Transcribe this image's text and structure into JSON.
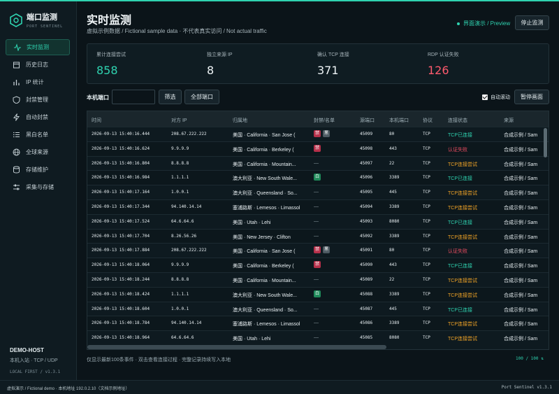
{
  "app": {
    "logo_title": "端口监测",
    "logo_subtitle": "PORT SENTINEL"
  },
  "sidebar": {
    "items": [
      {
        "label": "实时监测",
        "icon": "activity-icon",
        "active": true
      },
      {
        "label": "历史日志",
        "icon": "calendar-icon",
        "active": false
      },
      {
        "label": "IP 统计",
        "icon": "bar-chart-icon",
        "active": false
      },
      {
        "label": "封禁管理",
        "icon": "shield-icon",
        "active": false
      },
      {
        "label": "自动封禁",
        "icon": "bolt-icon",
        "active": false
      },
      {
        "label": "黑白名单",
        "icon": "list-icon",
        "active": false
      },
      {
        "label": "全球来源",
        "icon": "globe-icon",
        "active": false
      },
      {
        "label": "存储维护",
        "icon": "database-icon",
        "active": false
      },
      {
        "label": "采集与存储",
        "icon": "sliders-icon",
        "active": false
      }
    ],
    "host_name": "DEMO-HOST",
    "host_mode": "本机入站 · TCP / UDP",
    "version_line": "LOCAL FIRST  /  v1.3.1"
  },
  "header": {
    "title": "实时监测",
    "subtitle": "虚拟示例数据 / Fictional sample data · 不代表真实访问 / Not actual traffic",
    "preview_label": "界面演示 / Preview",
    "stop_button": "停止监测"
  },
  "stats": [
    {
      "label": "累计连接尝试",
      "value": "858",
      "color": "#2fd3b0"
    },
    {
      "label": "独立来源 IP",
      "value": "8",
      "color": "#eef4f6"
    },
    {
      "label": "确认 TCP 连接",
      "value": "371",
      "color": "#eef4f6"
    },
    {
      "label": "RDP 认证失败",
      "value": "126",
      "color": "#ff5a6e"
    }
  ],
  "filter": {
    "label": "本机端口",
    "input_value": "",
    "filter_button": "筛选",
    "all_ports_button": "全部端口",
    "auto_scroll_label": "自动滚动",
    "auto_scroll_checked": true,
    "pause_button": "暂停画面"
  },
  "table": {
    "columns": [
      "时间",
      "对方 IP",
      "归属地",
      "封禁/名单",
      "源端口",
      "本机端口",
      "协议",
      "连接状态",
      "来源"
    ],
    "rows": [
      {
        "time": "2026-09-13 15:40:16.444",
        "ip": "208.67.222.222",
        "location": "美国 · California · San Jose (",
        "badges": [
          "禁",
          "黑"
        ],
        "src_port": "45099",
        "local_port": "80",
        "proto": "TCP",
        "status": "TCP已连接",
        "status_type": "ok",
        "source": "合成示例 / Sam"
      },
      {
        "time": "2026-09-13 15:40:16.624",
        "ip": "9.9.9.9",
        "location": "美国 · California · Berkeley (",
        "badges": [
          "禁"
        ],
        "src_port": "45098",
        "local_port": "443",
        "proto": "TCP",
        "status": "认证失败",
        "status_type": "fail",
        "source": "合成示例 / Sam"
      },
      {
        "time": "2026-09-13 15:40:16.804",
        "ip": "8.8.8.8",
        "location": "美国 · California · Mountain...",
        "badges": [],
        "src_port": "45097",
        "local_port": "22",
        "proto": "TCP",
        "status": "TCP连接尝试",
        "status_type": "try",
        "source": "合成示例 / Sam"
      },
      {
        "time": "2026-09-13 15:40:16.984",
        "ip": "1.1.1.1",
        "location": "澳大利亚 · New South Wale...",
        "badges": [
          "白"
        ],
        "src_port": "45096",
        "local_port": "3389",
        "proto": "TCP",
        "status": "TCP已连接",
        "status_type": "ok",
        "source": "合成示例 / Sam"
      },
      {
        "time": "2026-09-13 15:40:17.164",
        "ip": "1.0.0.1",
        "location": "澳大利亚 · Queensland · So...",
        "badges": [],
        "src_port": "45095",
        "local_port": "445",
        "proto": "TCP",
        "status": "TCP连接尝试",
        "status_type": "try",
        "source": "合成示例 / Sam"
      },
      {
        "time": "2026-09-13 15:40:17.344",
        "ip": "94.140.14.14",
        "location": "塞浦路斯 · Lemesos · Limassol",
        "badges": [],
        "src_port": "45094",
        "local_port": "3389",
        "proto": "TCP",
        "status": "TCP连接尝试",
        "status_type": "try",
        "source": "合成示例 / Sam"
      },
      {
        "time": "2026-09-13 15:40:17.524",
        "ip": "64.6.64.6",
        "location": "美国 · Utah · Lehi",
        "badges": [],
        "src_port": "45093",
        "local_port": "8080",
        "proto": "TCP",
        "status": "TCP已连接",
        "status_type": "ok",
        "source": "合成示例 / Sam"
      },
      {
        "time": "2026-09-13 15:40:17.704",
        "ip": "8.26.56.26",
        "location": "美国 · New Jersey · Clifton",
        "badges": [],
        "src_port": "45092",
        "local_port": "3389",
        "proto": "TCP",
        "status": "TCP连接尝试",
        "status_type": "try",
        "source": "合成示例 / Sam"
      },
      {
        "time": "2026-09-13 15:40:17.884",
        "ip": "208.67.222.222",
        "location": "美国 · California · San Jose (",
        "badges": [
          "禁",
          "黑"
        ],
        "src_port": "45091",
        "local_port": "80",
        "proto": "TCP",
        "status": "认证失败",
        "status_type": "fail",
        "source": "合成示例 / Sam"
      },
      {
        "time": "2026-09-13 15:40:18.064",
        "ip": "9.9.9.9",
        "location": "美国 · California · Berkeley (",
        "badges": [
          "禁"
        ],
        "src_port": "45090",
        "local_port": "443",
        "proto": "TCP",
        "status": "TCP已连接",
        "status_type": "ok",
        "source": "合成示例 / Sam"
      },
      {
        "time": "2026-09-13 15:40:18.244",
        "ip": "8.8.8.8",
        "location": "美国 · California · Mountain...",
        "badges": [],
        "src_port": "45089",
        "local_port": "22",
        "proto": "TCP",
        "status": "TCP连接尝试",
        "status_type": "try",
        "source": "合成示例 / Sam"
      },
      {
        "time": "2026-09-13 15:40:18.424",
        "ip": "1.1.1.1",
        "location": "澳大利亚 · New South Wale...",
        "badges": [
          "白"
        ],
        "src_port": "45088",
        "local_port": "3389",
        "proto": "TCP",
        "status": "TCP连接尝试",
        "status_type": "try",
        "source": "合成示例 / Sam"
      },
      {
        "time": "2026-09-13 15:40:18.604",
        "ip": "1.0.0.1",
        "location": "澳大利亚 · Queensland · So...",
        "badges": [],
        "src_port": "45087",
        "local_port": "445",
        "proto": "TCP",
        "status": "TCP已连接",
        "status_type": "ok",
        "source": "合成示例 / Sam"
      },
      {
        "time": "2026-09-13 15:40:18.784",
        "ip": "94.140.14.14",
        "location": "塞浦路斯 · Lemesos · Limassol",
        "badges": [],
        "src_port": "45086",
        "local_port": "3389",
        "proto": "TCP",
        "status": "TCP连接尝试",
        "status_type": "try",
        "source": "合成示例 / Sam"
      },
      {
        "time": "2026-09-13 15:40:18.964",
        "ip": "64.6.64.6",
        "location": "美国 · Utah · Lehi",
        "badges": [],
        "src_port": "45085",
        "local_port": "8080",
        "proto": "TCP",
        "status": "TCP连接尝试",
        "status_type": "try",
        "source": "合成示例 / Sam"
      }
    ]
  },
  "footer": {
    "note": "仅显示最新100条事件 · 双击查看连接过程 · 完整记录持续写入本地",
    "count": "100 / 100 ⇅"
  },
  "statusbar": {
    "left": "虚拟演示 / Fictional demo · 本机地址 192.0.2.10（文档示例地址）",
    "right": "Port Sentinel v1.3.1"
  }
}
